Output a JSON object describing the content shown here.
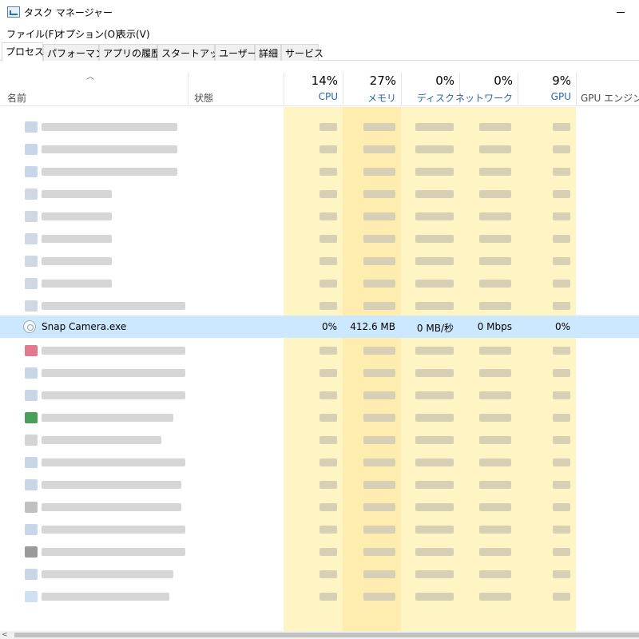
{
  "window": {
    "title": "タスク マネージャー"
  },
  "menu": [
    "ファイル(F)",
    "オプション(O)",
    "表示(V)"
  ],
  "tabs": [
    "プロセス",
    "パフォーマンス",
    "アプリの履歴",
    "スタートアップ",
    "ユーザー",
    "詳細",
    "サービス"
  ],
  "columns": {
    "name": "名前",
    "status": "状態",
    "cpu": {
      "percent": "14%",
      "label": "CPU"
    },
    "memory": {
      "percent": "27%",
      "label": "メモリ"
    },
    "disk": {
      "percent": "0%",
      "label": "ディスク"
    },
    "network": {
      "percent": "0%",
      "label": "ネットワーク"
    },
    "gpu": {
      "percent": "9%",
      "label": "GPU"
    },
    "gpu_engine": "GPU エンジン"
  },
  "selected_process": {
    "name": "Snap Camera.exe",
    "cpu": "0%",
    "memory": "412.6 MB",
    "disk": "0 MB/秒",
    "network": "0 Mbps",
    "gpu": "0%"
  },
  "icons": [
    "app-icon",
    "sort-up-icon",
    "snap-camera-icon",
    "scroll-left-icon"
  ],
  "colors": {
    "selection": "#cce8ff",
    "column_highlight_light": "#fff4c4",
    "column_highlight_memory": "#ffedb0",
    "header_label": "#2b66a8"
  }
}
